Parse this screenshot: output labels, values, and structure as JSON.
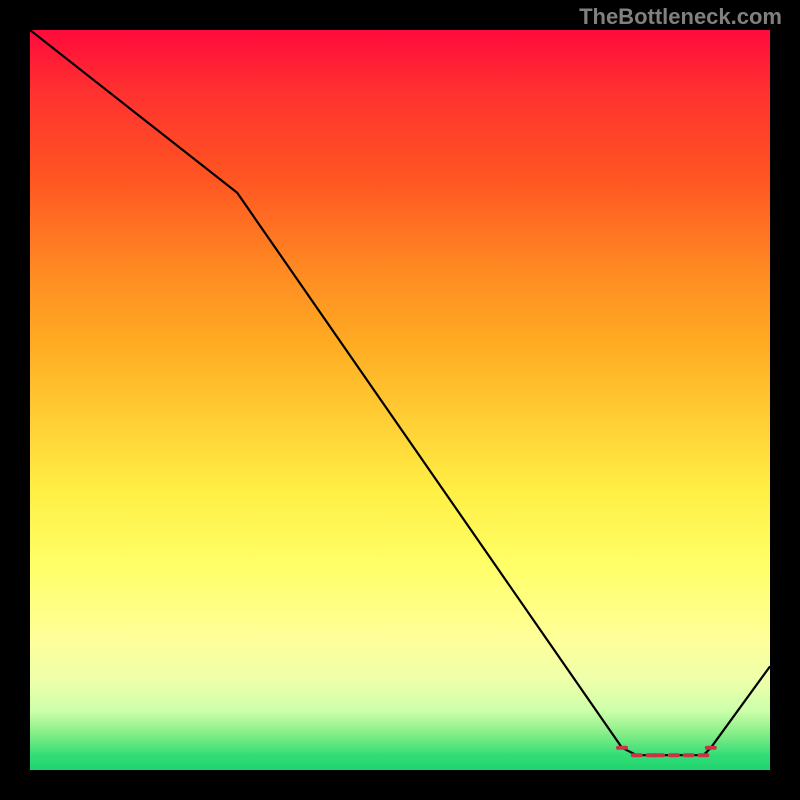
{
  "watermark": "TheBottleneck.com",
  "chart_data": {
    "type": "line",
    "title": "",
    "xlabel": "",
    "ylabel": "",
    "xlim": [
      0,
      100
    ],
    "ylim": [
      0,
      100
    ],
    "series": [
      {
        "name": "bottleneck-curve",
        "x": [
          0,
          28,
          80,
          82,
          84,
          85,
          87,
          89,
          91,
          92,
          100
        ],
        "y": [
          100,
          78,
          3,
          2,
          2,
          2,
          2,
          2,
          2,
          3,
          14
        ]
      }
    ],
    "markers": {
      "name": "optimal-range",
      "x": [
        80,
        82,
        84,
        85,
        87,
        89,
        91,
        92
      ],
      "y": [
        3,
        2,
        2,
        2,
        2,
        2,
        2,
        3
      ]
    },
    "gradient_stops": [
      {
        "pos": 0.0,
        "color": "#ff0a3c"
      },
      {
        "pos": 0.5,
        "color": "#ffd633"
      },
      {
        "pos": 0.82,
        "color": "#ffff99"
      },
      {
        "pos": 1.0,
        "color": "#1fd46d"
      }
    ]
  }
}
